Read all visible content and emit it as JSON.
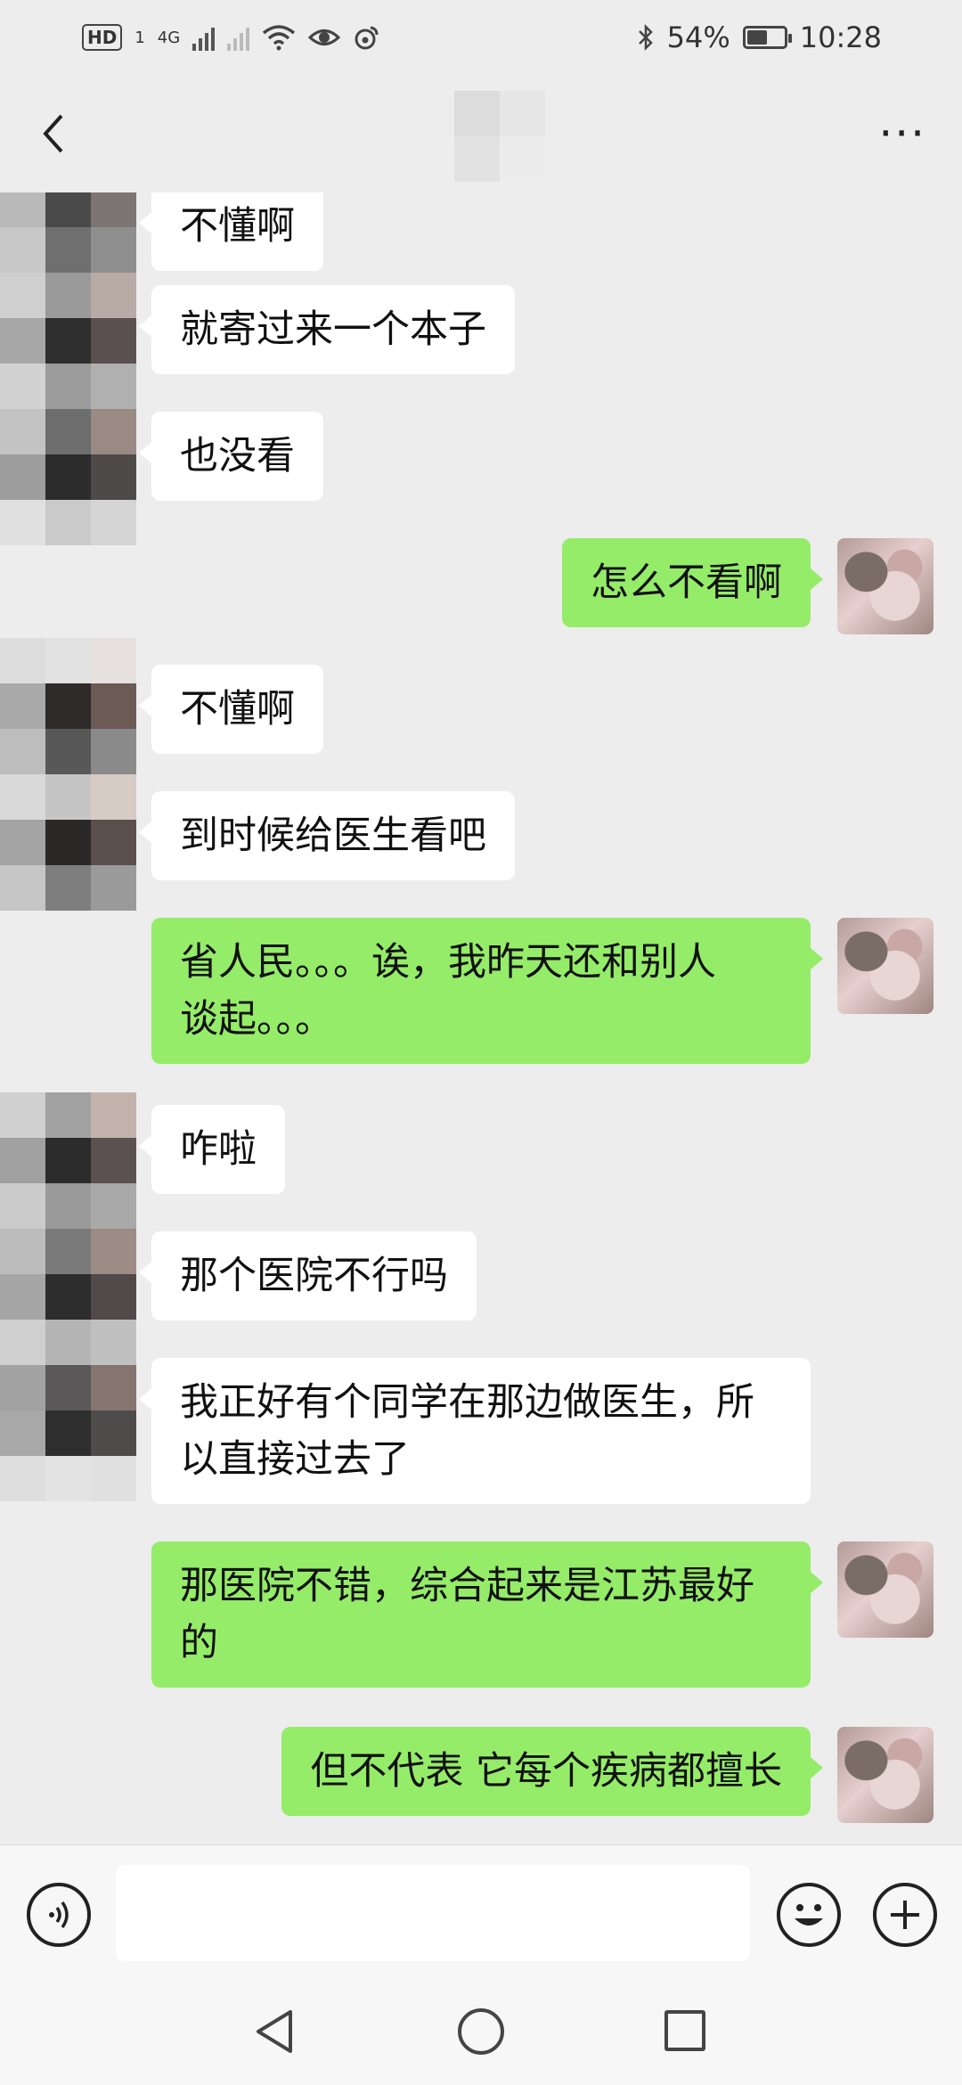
{
  "status_bar": {
    "left_badges": [
      "HD",
      "1"
    ],
    "network": "4G",
    "battery_percent": "54%",
    "battery_level": 0.54,
    "time": "10:28",
    "icons": [
      "signal-icon",
      "wifi-icon",
      "eye-icon",
      "weibo-icon",
      "bluetooth-icon",
      "battery-icon"
    ]
  },
  "header": {
    "back_icon": "chevron-left-icon",
    "more_icon": "more-dots-icon",
    "contact_avatar": "blurred-avatar"
  },
  "messages": [
    {
      "side": "left",
      "text": "不懂啊"
    },
    {
      "side": "left",
      "text": "就寄过来一个本子"
    },
    {
      "side": "left",
      "text": "也没看"
    },
    {
      "side": "right",
      "text": "怎么不看啊"
    },
    {
      "side": "left",
      "text": "不懂啊"
    },
    {
      "side": "left",
      "text": "到时候给医生看吧"
    },
    {
      "side": "right",
      "text": "省人民。。。诶，我昨天还和别人\n谈起。。。"
    },
    {
      "side": "left",
      "text": "咋啦"
    },
    {
      "side": "left",
      "text": "那个医院不行吗"
    },
    {
      "side": "left",
      "text": "我正好有个同学在那边做医生，所\n以直接过去了"
    },
    {
      "side": "right",
      "text": "那医院不错，综合起来是江苏最好\n的"
    },
    {
      "side": "right",
      "text": "但不代表 它每个疾病都擅长"
    }
  ],
  "input_bar": {
    "voice_icon": "voice-icon",
    "text_value": "",
    "emoji_icon": "emoji-icon",
    "plus_icon": "plus-icon"
  },
  "nav_bar": {
    "icons": [
      "nav-back-icon",
      "nav-home-icon",
      "nav-recent-icon"
    ]
  },
  "colors": {
    "background": "#ededed",
    "bubble_self": "#95ec69",
    "bubble_other": "#ffffff"
  }
}
